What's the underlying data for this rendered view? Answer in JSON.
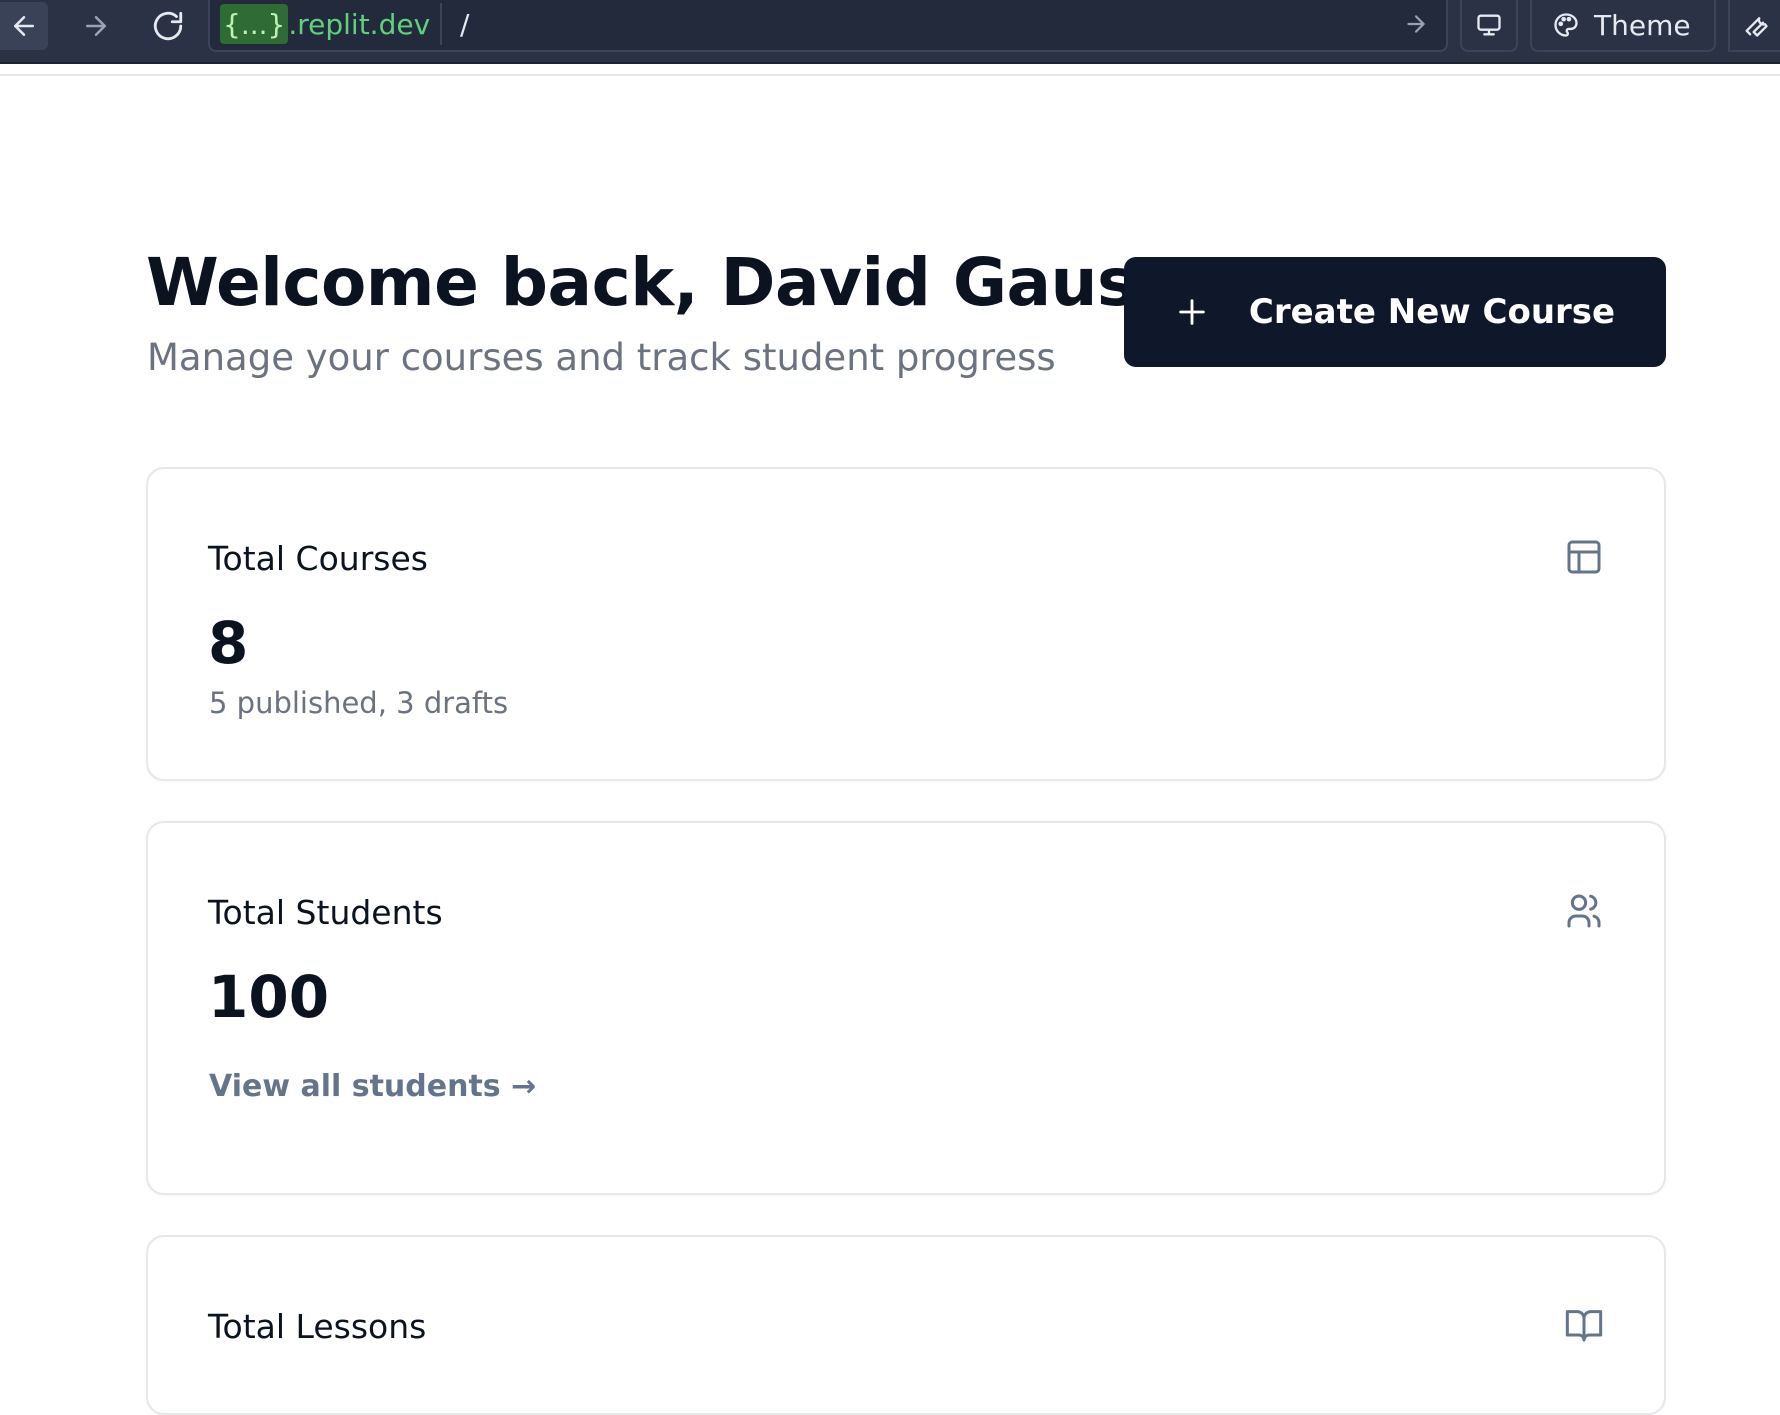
{
  "browser": {
    "url_host_brace": "{...}",
    "url_host_domain": ".replit.dev",
    "url_path": "/",
    "theme_label": "Theme"
  },
  "header": {
    "title": "Welcome back, David Gaus!",
    "subtitle": "Manage your courses and track student progress",
    "create_button_label": "Create New Course"
  },
  "stats": {
    "courses": {
      "title": "Total Courses",
      "value": "8",
      "note": "5 published, 3 drafts",
      "icon": "layout-icon"
    },
    "students": {
      "title": "Total Students",
      "value": "100",
      "link": "View all students →",
      "icon": "users-icon"
    },
    "lessons": {
      "title": "Total Lessons",
      "icon": "book-open-icon"
    }
  },
  "colors": {
    "chrome_bg": "#2b3245",
    "primary_button": "#0f172a",
    "url_green": "#5fd07d",
    "muted_text": "#6b7280",
    "card_border": "#e5e7eb"
  }
}
